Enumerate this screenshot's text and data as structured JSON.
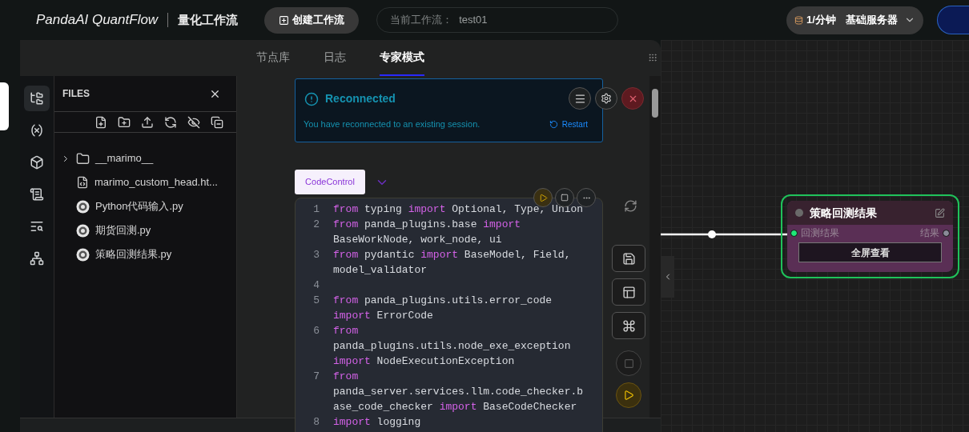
{
  "header": {
    "logo": "PandaAI QuantFlow",
    "subtitle": "量化工作流",
    "create_button": "创建工作流",
    "workflow_label": "当前工作流：",
    "workflow_name": "test01",
    "rate": "1/分钟",
    "server": "基础服务器"
  },
  "tabs": [
    {
      "label": "节点库",
      "selected": false
    },
    {
      "label": "日志",
      "selected": false
    },
    {
      "label": "专家模式",
      "selected": true
    }
  ],
  "activity_bar": [
    {
      "kind": "files",
      "selected": true
    },
    {
      "kind": "variables",
      "selected": false
    },
    {
      "kind": "packages",
      "selected": false
    },
    {
      "kind": "outline",
      "selected": false
    },
    {
      "kind": "search",
      "selected": false
    },
    {
      "kind": "dependencies",
      "selected": false
    }
  ],
  "files_panel": {
    "title": "FILES",
    "items": [
      {
        "kind": "folder",
        "name": "__marimo__",
        "expanded": false
      },
      {
        "kind": "html",
        "name": "marimo_custom_head.ht..."
      },
      {
        "kind": "notebook",
        "name": "Python代码输入.py"
      },
      {
        "kind": "notebook",
        "name": "期货回测.py"
      },
      {
        "kind": "notebook",
        "name": "策略回测结果.py"
      }
    ]
  },
  "toast": {
    "title": "Reconnected",
    "message": "You have reconnected to an existing session.",
    "action": "Restart"
  },
  "cell": {
    "tag": "CodeControl",
    "lines": [
      {
        "num": "1",
        "tokens": [
          {
            "kind": "kw",
            "text": "from"
          },
          {
            "kind": "id",
            "text": " typing "
          },
          {
            "kind": "kw",
            "text": "import"
          },
          {
            "kind": "id",
            "text": " Optional, Type, Union"
          }
        ]
      },
      {
        "num": "2",
        "tokens": [
          {
            "kind": "kw",
            "text": "from"
          },
          {
            "kind": "id",
            "text": " panda_plugins.base "
          },
          {
            "kind": "kw",
            "text": "import"
          },
          {
            "kind": "id",
            "text": " BaseWorkNode, work_node, ui"
          }
        ]
      },
      {
        "num": "3",
        "tokens": [
          {
            "kind": "kw",
            "text": "from"
          },
          {
            "kind": "id",
            "text": " pydantic "
          },
          {
            "kind": "kw",
            "text": "import"
          },
          {
            "kind": "id",
            "text": " BaseModel, Field, model_validator"
          }
        ]
      },
      {
        "num": "4"
      },
      {
        "num": "5",
        "tokens": [
          {
            "kind": "kw",
            "text": "from"
          },
          {
            "kind": "id",
            "text": " panda_plugins.utils.error_code "
          },
          {
            "kind": "kw",
            "text": "import"
          },
          {
            "kind": "id",
            "text": " ErrorCode"
          }
        ]
      },
      {
        "num": "6",
        "tokens": [
          {
            "kind": "kw",
            "text": "from"
          },
          {
            "kind": "id",
            "text": " panda_plugins.utils.node_exe_exception "
          },
          {
            "kind": "kw",
            "text": "import"
          },
          {
            "kind": "id",
            "text": " NodeExecutionException"
          }
        ]
      },
      {
        "num": "7",
        "tokens": [
          {
            "kind": "kw",
            "text": "from"
          },
          {
            "kind": "id",
            "text": " panda_server.services.llm.code_checker.base_code_checker "
          },
          {
            "kind": "kw",
            "text": "import"
          },
          {
            "kind": "id",
            "text": " BaseCodeChecker"
          }
        ]
      },
      {
        "num": "8",
        "tokens": [
          {
            "kind": "kw",
            "text": "import"
          },
          {
            "kind": "id",
            "text": " logging"
          }
        ]
      }
    ]
  },
  "node": {
    "title": "策略回测结果",
    "input": "回测结果",
    "output": "结果",
    "button": "全屏查看",
    "selected": true
  }
}
